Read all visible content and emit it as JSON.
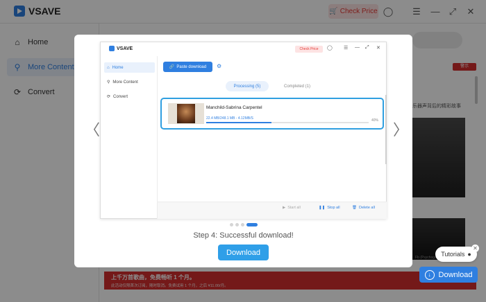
{
  "app": {
    "title": "VSAVE",
    "check_price": "Check Price",
    "header_icons": [
      "user-icon",
      "menu-icon",
      "minimize-icon",
      "maximize-icon",
      "close-icon"
    ]
  },
  "sidebar": {
    "items": [
      {
        "label": "Home",
        "icon": "home-icon"
      },
      {
        "label": "More Content",
        "icon": "more-content-icon"
      },
      {
        "label": "Convert",
        "icon": "convert-icon"
      }
    ]
  },
  "background": {
    "badge": "警示",
    "text_line": "乐器声背后的精彩故事",
    "caption": "Fb (Psychogal",
    "promo_title": "上千万首歌曲，免费畅听 1 个月。",
    "promo_sub": "此活动仅限首次订阅，随时取消。免费试用 1 个月，之后 ¥11.00/月。"
  },
  "tutorial_widget": {
    "label": "Tutorials"
  },
  "float_download": {
    "label": "Download"
  },
  "modal": {
    "preview": {
      "app_title": "VSAVE",
      "check_price": "Check Price",
      "sidebar": [
        "Home",
        "More Content",
        "Convert"
      ],
      "paste_button": "Paste download",
      "tabs": {
        "processing": "Processing (5)",
        "completed": "Completed (1)"
      },
      "item": {
        "title": "Manchild-Sabrina Carpentel",
        "progress_text": "22.4 MB/248.1 MB - 4.12MB/S",
        "percent": "40%",
        "progress_fraction": 0.4
      },
      "footer": {
        "start_all": "Start all",
        "stop_all": "Stop all",
        "delete_all": "Delete all"
      }
    },
    "carousel": {
      "total": 4,
      "active": 4
    },
    "step_text": "Step 4: Successful download!",
    "download_button": "Download",
    "prev_arrow": "〈",
    "next_arrow": "〉"
  },
  "colors": {
    "accent": "#2f7fe0",
    "danger": "#e53935",
    "promo": "#d32f2f"
  }
}
